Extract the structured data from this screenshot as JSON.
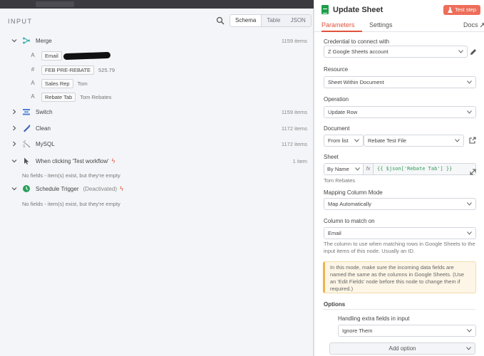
{
  "input_panel": {
    "title": "INPUT",
    "view_tabs": [
      "Schema",
      "Table",
      "JSON"
    ],
    "nodes": [
      {
        "name": "Merge",
        "count": "1159 items",
        "expanded": true,
        "fields": [
          {
            "type": "A",
            "name": "Email",
            "value": ""
          },
          {
            "type": "#",
            "name": "FEB PRE-REBATE",
            "value": "525.79"
          },
          {
            "type": "A",
            "name": "Sales Rep",
            "value": "Tom"
          },
          {
            "type": "A",
            "name": "Rebate Tab",
            "value": "Tom Rebates"
          }
        ]
      },
      {
        "name": "Switch",
        "count": "1159 items"
      },
      {
        "name": "Clean",
        "count": "1172 items"
      },
      {
        "name": "MySQL",
        "count": "1172 items"
      },
      {
        "name": "When clicking 'Test workflow'",
        "count": "1 item",
        "note": "No fields - item(s) exist, but they're empty"
      },
      {
        "name": "Schedule Trigger",
        "sub": "(Deactivated)",
        "note": "No fields - item(s) exist, but they're empty"
      }
    ]
  },
  "node_panel": {
    "title": "Update Sheet",
    "test_button": "Test step",
    "tabs": [
      "Parameters",
      "Settings"
    ],
    "docs": "Docs",
    "credential": {
      "label": "Credential to connect with",
      "value": "Z Google Sheets account"
    },
    "resource": {
      "label": "Resource",
      "value": "Sheet Within Document"
    },
    "operation": {
      "label": "Operation",
      "value": "Update Row"
    },
    "document": {
      "label": "Document",
      "mode": "From list",
      "value": "Rebate Test File"
    },
    "sheet": {
      "label": "Sheet",
      "mode": "By Name",
      "fx": "fx",
      "expression": "{{ $json['Rebate Tab'] }}",
      "resolved": "Tom Rebates"
    },
    "mapping_mode": {
      "label": "Mapping Column Mode",
      "value": "Map Automatically"
    },
    "match_column": {
      "label": "Column to match on",
      "value": "Email",
      "hint": "The column to use when matching rows in Google Sheets to the input items of this node. Usually an ID."
    },
    "notice": "In this mode, make sure the incoming data fields are named the same as the columns in Google Sheets. (Use an 'Edit Fields' node before this node to change them if required.)",
    "options": {
      "label": "Options",
      "extra_label": "Handling extra fields in input",
      "extra_value": "Ignore Them",
      "add_option": "Add option"
    }
  },
  "colors": {
    "accent": "#e0533d",
    "test_button": "#ee6e5a",
    "sheets_green": "#1e9e4a",
    "notice_bg": "#fdf6e7",
    "notice_border": "#f0b44b"
  },
  "icons": [
    "search-icon",
    "merge-icon",
    "switch-icon",
    "clean-icon",
    "mysql-icon",
    "pointer-icon",
    "clock-icon",
    "bolt-icon",
    "flask-icon",
    "pencil-icon",
    "external-link-icon",
    "expand-icon",
    "chevron-down-icon",
    "chevron-right-icon"
  ]
}
